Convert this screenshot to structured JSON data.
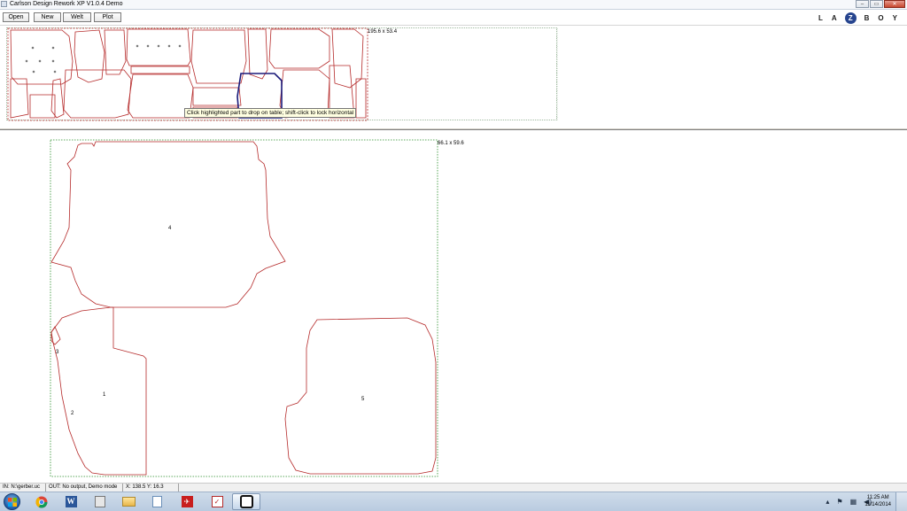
{
  "window": {
    "title": "Carlson Design Rework XP V1.0.4  Demo",
    "controls": [
      "‒",
      "▭",
      "✕"
    ]
  },
  "toolbar": {
    "buttons": [
      "Open",
      "New",
      "Welt",
      "Plot"
    ]
  },
  "brand": {
    "letters": [
      "L",
      "A",
      "Z",
      "B",
      "O",
      "Y"
    ]
  },
  "strip": {
    "dimension": "195.6 x 53.4"
  },
  "tooltip": "Click highlighted part to drop on table; shift-click to lock horizontal",
  "table": {
    "dimension": "66.1 x 59.6",
    "part_labels": [
      "4",
      "3",
      "1",
      "2",
      "5"
    ]
  },
  "statusbar": {
    "in": "IN: N:\\gerber.uc",
    "out": "OUT: No output, Demo mode",
    "coords": "X: 138.5  Y: 16.3"
  },
  "taskbar": {
    "apps": [
      "windows-explorer",
      "chrome",
      "word",
      "print",
      "folder",
      "notes",
      "acrobat",
      "checklist",
      "carlson-app"
    ],
    "clock": {
      "time": "11:25 AM",
      "date": "11/14/2014"
    }
  },
  "colors": {
    "part_outline": "#b52a2a",
    "selected_part": "#1a1a7a",
    "boundary": "#2a8f2a"
  }
}
